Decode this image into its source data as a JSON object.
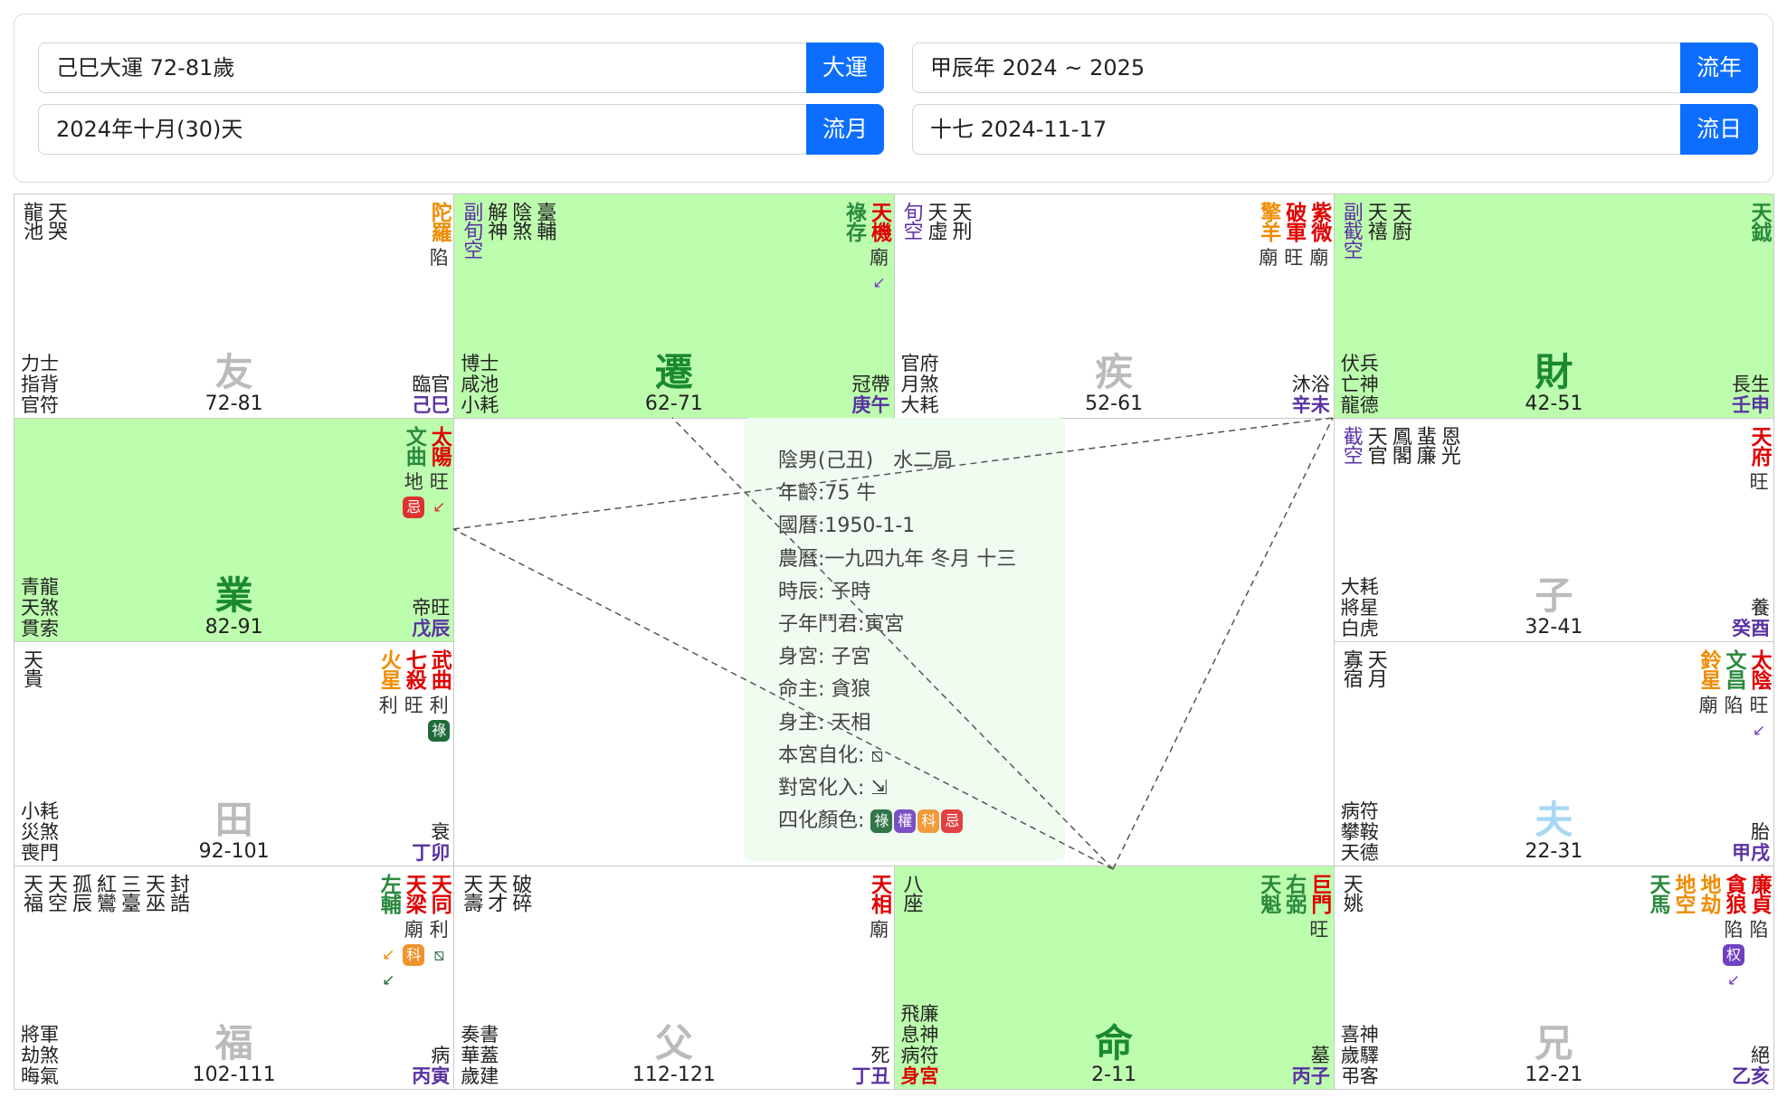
{
  "header": {
    "dayun": {
      "value": "己巳大運 72-81歲",
      "button": "大運"
    },
    "liunian": {
      "value": "甲辰年 2024 ~ 2025",
      "button": "流年"
    },
    "liuyue": {
      "value": "2024年十月(30)天",
      "button": "流月"
    },
    "liuri": {
      "value": "十七 2024-11-17",
      "button": "流日"
    }
  },
  "colors": {
    "highlight": "#bdfdae",
    "button": "#0d6efd",
    "lu": "#1f6b3a",
    "quan": "#6f42c1",
    "ke": "#f0932b",
    "ji": "#e03131"
  },
  "cells": [
    {
      "palace": "友",
      "palace_color": "#bbbbbb",
      "ages": "72-81",
      "minor": [
        "龍池",
        "天哭"
      ],
      "lower_left": [
        "力士",
        "指背",
        "官符"
      ],
      "changsheng": "臨官",
      "ganzhi": "己巳",
      "stars": [
        {
          "name": "陀羅",
          "color": "#f08c00",
          "bright": "陷",
          "flags": []
        }
      ]
    },
    {
      "palace": "遷",
      "palace_color": "#1b8a2f",
      "ages": "62-71",
      "minor": [
        "副旬空",
        "解神",
        "陰煞",
        "臺輔"
      ],
      "lower_left": [
        "博士",
        "咸池",
        "小耗"
      ],
      "changsheng": "冠帶",
      "ganzhi": "庚午",
      "stars": [
        {
          "name": "天機",
          "color": "#e00000",
          "bright": "廟",
          "flags": [
            {
              "type": "arrow",
              "char": "↙",
              "color": "#6f42c1"
            }
          ]
        },
        {
          "name": "祿存",
          "color": "#2b8a3e",
          "bright": "",
          "flags": []
        }
      ]
    },
    {
      "palace": "疾",
      "palace_color": "#bbbbbb",
      "ages": "52-61",
      "minor": [
        "旬空",
        "天虛",
        "天刑"
      ],
      "lower_left": [
        "官府",
        "月煞",
        "大耗"
      ],
      "changsheng": "沐浴",
      "ganzhi": "辛未",
      "stars": [
        {
          "name": "紫微",
          "color": "#e00000",
          "bright": "廟",
          "flags": []
        },
        {
          "name": "破軍",
          "color": "#e00000",
          "bright": "旺",
          "flags": []
        },
        {
          "name": "擎羊",
          "color": "#f08c00",
          "bright": "廟",
          "flags": []
        }
      ]
    },
    {
      "palace": "財",
      "palace_color": "#1b8a2f",
      "ages": "42-51",
      "minor": [
        "副截空",
        "天禧",
        "天廚"
      ],
      "lower_left": [
        "伏兵",
        "亡神",
        "龍德"
      ],
      "changsheng": "長生",
      "ganzhi": "壬申",
      "stars": [
        {
          "name": "天鉞",
          "color": "#2b8a3e",
          "bright": "",
          "flags": []
        }
      ]
    },
    {
      "palace": "業",
      "palace_color": "#1b8a2f",
      "ages": "82-91",
      "minor": [],
      "lower_left": [
        "青龍",
        "天煞",
        "貫索"
      ],
      "changsheng": "帝旺",
      "ganzhi": "戊辰",
      "stars": [
        {
          "name": "太陽",
          "color": "#e00000",
          "bright": "旺",
          "flags": [
            {
              "type": "arrow",
              "char": "↙",
              "color": "#e03131"
            }
          ]
        },
        {
          "name": "文曲",
          "color": "#2b8a3e",
          "bright": "地",
          "flags": [
            {
              "type": "tag",
              "char": "忌",
              "color": "#e03131"
            }
          ]
        }
      ]
    },
    {
      "palace": "子",
      "palace_color": "#bbbbbb",
      "ages": "32-41",
      "minor": [
        "截空",
        "天官",
        "鳳閣",
        "蜚廉",
        "恩光"
      ],
      "lower_left": [
        "大耗",
        "將星",
        "白虎"
      ],
      "changsheng": "養",
      "ganzhi": "癸酉",
      "stars": [
        {
          "name": "天府",
          "color": "#e00000",
          "bright": "旺",
          "flags": []
        }
      ]
    },
    {
      "palace": "田",
      "palace_color": "#bbbbbb",
      "ages": "92-101",
      "minor": [
        "天貴"
      ],
      "lower_left": [
        "小耗",
        "災煞",
        "喪門"
      ],
      "changsheng": "衰",
      "ganzhi": "丁卯",
      "stars": [
        {
          "name": "武曲",
          "color": "#e00000",
          "bright": "利",
          "flags": [
            {
              "type": "tag",
              "char": "祿",
              "color": "#1f6b3a"
            }
          ]
        },
        {
          "name": "七殺",
          "color": "#e00000",
          "bright": "旺",
          "flags": []
        },
        {
          "name": "火星",
          "color": "#f08c00",
          "bright": "利",
          "flags": []
        }
      ]
    },
    {
      "palace": "夫",
      "palace_color": "#a9d8f5",
      "ages": "22-31",
      "minor": [
        "寡宿",
        "天月"
      ],
      "lower_left": [
        "病符",
        "攀鞍",
        "天德"
      ],
      "changsheng": "胎",
      "ganzhi": "甲戌",
      "stars": [
        {
          "name": "太陰",
          "color": "#e00000",
          "bright": "旺",
          "flags": [
            {
              "type": "arrow",
              "char": "↙",
              "color": "#6f42c1"
            }
          ]
        },
        {
          "name": "文昌",
          "color": "#2b8a3e",
          "bright": "陷",
          "flags": []
        },
        {
          "name": "鈴星",
          "color": "#f08c00",
          "bright": "廟",
          "flags": []
        }
      ]
    },
    {
      "palace": "福",
      "palace_color": "#bbbbbb",
      "ages": "102-111",
      "minor": [
        "天福",
        "天空",
        "孤辰",
        "紅鸞",
        "三臺",
        "天巫",
        "封誥"
      ],
      "lower_left": [
        "將軍",
        "劫煞",
        "晦氣"
      ],
      "changsheng": "病",
      "ganzhi": "丙寅",
      "stars": [
        {
          "name": "天同",
          "color": "#e00000",
          "bright": "利",
          "flags": [
            {
              "type": "tag",
              "char": "⧅",
              "color": "#1f6b3a",
              "outline": true
            }
          ]
        },
        {
          "name": "天梁",
          "color": "#e00000",
          "bright": "廟",
          "flags": [
            {
              "type": "tag",
              "char": "科",
              "color": "#f0932b"
            }
          ]
        },
        {
          "name": "左輔",
          "color": "#2b8a3e",
          "bright": "",
          "flags": [
            {
              "type": "arrow",
              "char": "↙",
              "color": "#f08c00"
            },
            {
              "type": "arrow",
              "char": "↙",
              "color": "#1f6b3a"
            }
          ]
        }
      ]
    },
    {
      "palace": "父",
      "palace_color": "#bbbbbb",
      "ages": "112-121",
      "minor": [
        "天壽",
        "天才",
        "破碎"
      ],
      "lower_left": [
        "奏書",
        "華蓋",
        "歲建"
      ],
      "changsheng": "死",
      "ganzhi": "丁丑",
      "stars": [
        {
          "name": "天相",
          "color": "#e00000",
          "bright": "廟",
          "flags": []
        }
      ]
    },
    {
      "palace": "命",
      "palace_color": "#1b8a2f",
      "ages": "2-11",
      "minor": [
        "八座"
      ],
      "lower_left": [
        "飛廉",
        "息神",
        "病符"
      ],
      "body_palace": "身宮",
      "changsheng": "墓",
      "ganzhi": "丙子",
      "stars": [
        {
          "name": "巨門",
          "color": "#e00000",
          "bright": "旺",
          "flags": []
        },
        {
          "name": "右弼",
          "color": "#2b8a3e",
          "bright": "",
          "flags": []
        },
        {
          "name": "天魁",
          "color": "#2b8a3e",
          "bright": "",
          "flags": []
        }
      ]
    },
    {
      "palace": "兄",
      "palace_color": "#bbbbbb",
      "ages": "12-21",
      "minor": [
        "天姚"
      ],
      "lower_left": [
        "喜神",
        "歲驛",
        "弔客"
      ],
      "changsheng": "絕",
      "ganzhi": "乙亥",
      "stars": [
        {
          "name": "廉貞",
          "color": "#e00000",
          "bright": "陷",
          "flags": []
        },
        {
          "name": "貪狼",
          "color": "#e00000",
          "bright": "陷",
          "flags": [
            {
              "type": "tag",
              "char": "权",
              "color": "#6f42c1"
            },
            {
              "type": "arrow",
              "char": "↙",
              "color": "#6f42c1"
            }
          ]
        },
        {
          "name": "地劫",
          "color": "#f08c00",
          "bright": "",
          "flags": []
        },
        {
          "name": "地空",
          "color": "#f08c00",
          "bright": "",
          "flags": []
        },
        {
          "name": "天馬",
          "color": "#2b8a3e",
          "bright": "",
          "flags": []
        }
      ]
    }
  ],
  "center": {
    "lines": [
      "陰男(己丑)　水二局",
      "年齡:75 牛",
      "國曆:1950-1-1",
      "農曆:一九四九年 冬月 十三",
      "時辰:  子時",
      "子年鬥君:寅宮",
      "身宮:  子宮",
      "命主:  貪狼",
      "身主:  天相",
      "本宮自化: ⧅",
      "對宮化入: ⇲"
    ],
    "colors_label": "四化顏色:",
    "sihua": [
      {
        "char": "祿",
        "color": "#1f6b3a"
      },
      {
        "char": "權",
        "color": "#6f42c1"
      },
      {
        "char": "科",
        "color": "#f0932b"
      },
      {
        "char": "忌",
        "color": "#e03131"
      }
    ]
  }
}
